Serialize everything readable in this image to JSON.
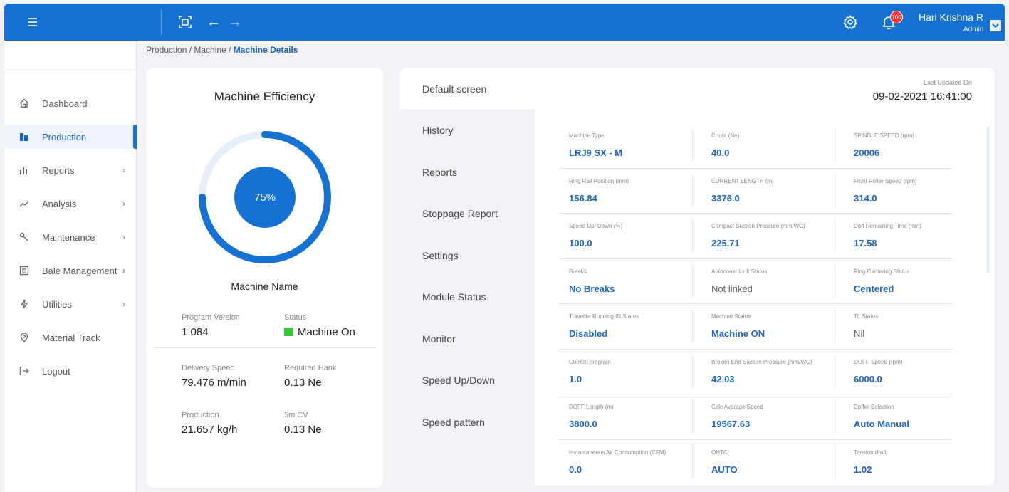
{
  "topbar": {
    "user_name": "Hari Krishna R",
    "user_role": "Admin",
    "notification_count": "100"
  },
  "breadcrumb": {
    "part1": "Production",
    "part2": "Machine",
    "current": "Machine Details",
    "sep": " / "
  },
  "sidebar": {
    "items": [
      {
        "label": "Dashboard",
        "icon": "home-icon"
      },
      {
        "label": "Production",
        "icon": "factory-icon",
        "active": true
      },
      {
        "label": "Reports",
        "icon": "bar-chart-icon",
        "chevron": true
      },
      {
        "label": "Analysis",
        "icon": "trend-icon",
        "chevron": true
      },
      {
        "label": "Maintenance",
        "icon": "wrench-icon",
        "chevron": true
      },
      {
        "label": "Bale Management",
        "icon": "list-icon",
        "chevron": true
      },
      {
        "label": "Utilities",
        "icon": "bolt-icon",
        "chevron": true
      },
      {
        "label": "Material Track",
        "icon": "location-icon"
      },
      {
        "label": "Logout",
        "icon": "logout-icon"
      }
    ]
  },
  "efficiency": {
    "title": "Machine Efficiency",
    "percent_text": "75%",
    "percent": 75,
    "machine_name": "Machine Name",
    "program_version_label": "Program Version",
    "program_version": "1.084",
    "status_label": "Status",
    "status": "Machine On",
    "delivery_speed_label": "Delivery Speed",
    "delivery_speed": "79.476 m/min",
    "required_hank_label": "Required Hank",
    "required_hank": "0.13 Ne",
    "production_label": "Production",
    "production": "21.657 kg/h",
    "cv_label": "5m CV",
    "cv": "0.13 Ne",
    "colors": {
      "arc": "#1572d3",
      "track": "#e6eefa",
      "status": "#37c935"
    }
  },
  "tabs": [
    "Default screen",
    "History",
    "Reports",
    "Stoppage Report",
    "Settings",
    "Module Status",
    "Monitor",
    "Speed Up/Down",
    "Speed pattern"
  ],
  "last_updated": {
    "label": "Last Updated On",
    "value": "09-02-2021 16:41:00"
  },
  "details": [
    [
      {
        "label": "Machine Type",
        "value": "LRJ9 SX - M"
      },
      {
        "label": "Count (Ne)",
        "value": "40.0"
      },
      {
        "label": "SPINDLE SPEED (rpm)",
        "value": "20006"
      }
    ],
    [
      {
        "label": "Ring Rail Position (mm)",
        "value": "156.84"
      },
      {
        "label": "CURRENT LENGTH (m)",
        "value": "3376.0"
      },
      {
        "label": "Front Roller Speed (rpm)",
        "value": "314.0"
      }
    ],
    [
      {
        "label": "Speed Up/ Down (%)",
        "value": "100.0"
      },
      {
        "label": "Compact Suction Pressure (mm/WC)",
        "value": "225.71"
      },
      {
        "label": "Doff Remaining Time (min)",
        "value": "17.58"
      }
    ],
    [
      {
        "label": "Breaks",
        "value": "No Breaks"
      },
      {
        "label": "Autoconer Link Status",
        "value": "Not linked",
        "plain": true
      },
      {
        "label": "Ring Centering Status",
        "value": "Centered"
      }
    ],
    [
      {
        "label": "Traveller Running IN Status",
        "value": "Disabled"
      },
      {
        "label": "Machine Status",
        "value": "Machine ON"
      },
      {
        "label": "TL Status",
        "value": "Nil",
        "plain": true
      }
    ],
    [
      {
        "label": "Current program",
        "value": "1.0"
      },
      {
        "label": "Broken End Suction Pressure (mm/WC)",
        "value": "42.03"
      },
      {
        "label": "DOFF Speed (rpm)",
        "value": "6000.0"
      }
    ],
    [
      {
        "label": "DOFF Length (m)",
        "value": "3800.0"
      },
      {
        "label": "Calc Average Speed",
        "value": "19567.63"
      },
      {
        "label": "Doffer Selection",
        "value": "Auto Manual"
      }
    ],
    [
      {
        "label": "Instantaneous Air Consumption (CFM)",
        "value": "0.0"
      },
      {
        "label": "OHTC",
        "value": "AUTO"
      },
      {
        "label": "Tension draft",
        "value": "1.02"
      }
    ]
  ]
}
